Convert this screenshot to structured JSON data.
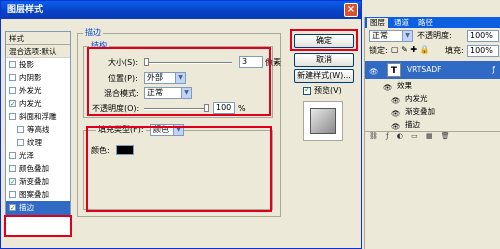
{
  "dialog": {
    "title": "图层样式",
    "close_glyph": "×"
  },
  "style_list": {
    "header": "样式",
    "blend_options": "混合选项:默认",
    "items": [
      {
        "label": "投影",
        "checked": false
      },
      {
        "label": "内阴影",
        "checked": false
      },
      {
        "label": "外发光",
        "checked": false
      },
      {
        "label": "内发光",
        "checked": true
      },
      {
        "label": "斜面和浮雕",
        "checked": false
      },
      {
        "label": "等高线",
        "checked": false
      },
      {
        "label": "纹理",
        "checked": false
      },
      {
        "label": "光泽",
        "checked": false
      },
      {
        "label": "颜色叠加",
        "checked": false
      },
      {
        "label": "渐变叠加",
        "checked": true
      },
      {
        "label": "图案叠加",
        "checked": false
      },
      {
        "label": "描边",
        "checked": true
      }
    ]
  },
  "stroke": {
    "group_title": "描边",
    "structure_title": "结构",
    "size_label": "大小(S):",
    "size_value": "3",
    "size_unit": "像素",
    "position_label": "位置(P):",
    "position_value": "外部",
    "blend_mode_label": "混合模式:",
    "blend_mode_value": "正常",
    "opacity_label": "不透明度(O):",
    "opacity_value": "100",
    "opacity_unit": "%",
    "fill_type_label": "填充类型(F):",
    "fill_type_value": "颜色",
    "color_label": "颜色:",
    "color_swatch": "#000000"
  },
  "buttons": {
    "ok": "确定",
    "cancel": "取消",
    "new_style": "新建样式(W)...",
    "preview_label": "预览(V)",
    "preview_checked": true
  },
  "layers_panel": {
    "tabs": [
      "图层",
      "通道",
      "路径"
    ],
    "blend_mode": "正常",
    "opacity_label": "不透明度:",
    "opacity_value": "100%",
    "lock_label": "锁定:",
    "fill_label": "填充:",
    "fill_value": "100%",
    "layer_name": "VRTSADF",
    "effects_label": "效果",
    "effects": [
      "内发光",
      "渐变叠加",
      "描边"
    ],
    "thumbnail_glyph": "T"
  },
  "colors": {
    "highlight_red": "#e0001b",
    "selection_blue": "#316ac5",
    "title_blue": "#0842c6"
  }
}
